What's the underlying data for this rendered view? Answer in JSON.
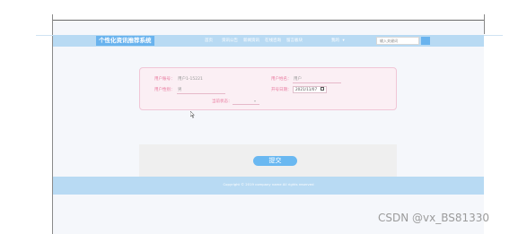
{
  "brand": "个性化资讯推荐系统",
  "nav": {
    "items": [
      "首页",
      "资讯公告",
      "新闻资讯",
      "在线咨询",
      "留言板块"
    ],
    "user": "我的",
    "dropdown_caret": "▾",
    "search_placeholder": "输入关键词"
  },
  "form": {
    "account_label": "用户账号：",
    "account_value": "用户1-15221",
    "name_label": "用户姓名：",
    "name_value": "用户",
    "gender_label": "用户性别：",
    "gender_value": "男",
    "date_label": "开号日期：",
    "date_value": "2021/11/07",
    "status_label": "当前状态："
  },
  "submit_label": "提交",
  "footer": {
    "copyright": "Copyright © 2019 company name All rights reserved"
  },
  "watermark": "CSDN @vx_BS81330"
}
